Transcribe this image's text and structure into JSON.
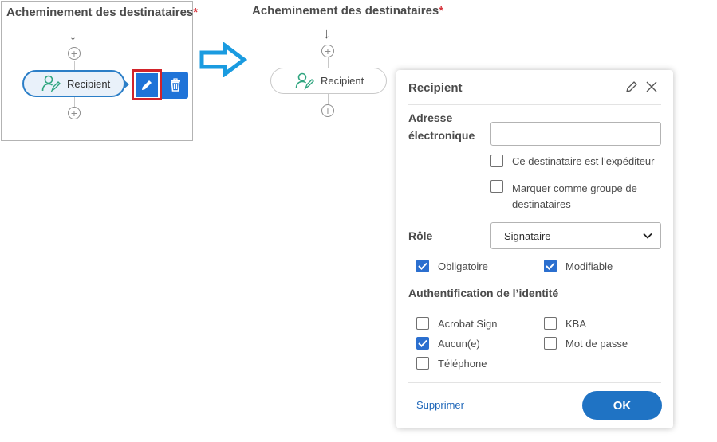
{
  "left": {
    "title": "Acheminement des destinataires",
    "required_mark": "*",
    "recipient_label": "Recipient",
    "edit_icon": "pencil-icon",
    "delete_icon": "trash-icon"
  },
  "transition_arrow": "right-arrow-icon",
  "right": {
    "title": "Acheminement des destinataires",
    "required_mark": "*",
    "recipient_label": "Recipient"
  },
  "panel": {
    "title": "Recipient",
    "email_label_line1": "Adresse",
    "email_label_line2": "électronique",
    "email_value": "",
    "sender_checkbox": {
      "label": "Ce destinataire est l’expéditeur",
      "checked": false
    },
    "group_checkbox": {
      "label_line1": "Marquer comme groupe de",
      "label_line2": "destinataires",
      "checked": false
    },
    "role_label": "Rôle",
    "role_value": "Signataire",
    "required_checkbox": {
      "label": "Obligatoire",
      "checked": true
    },
    "editable_checkbox": {
      "label": "Modifiable",
      "checked": true
    },
    "auth_title": "Authentification de l’identité",
    "auth_options": [
      {
        "label": "Acrobat Sign",
        "checked": false
      },
      {
        "label": "KBA",
        "checked": false
      },
      {
        "label": "Aucun(e)",
        "checked": true
      },
      {
        "label": "Mot de passe",
        "checked": false
      },
      {
        "label": "Téléphone",
        "checked": false
      }
    ],
    "delete_link": "Supprimer",
    "ok_button": "OK"
  },
  "colors": {
    "accent": "#1f73c4",
    "highlight_frame": "#d2232a",
    "required": "#d7373f",
    "recipient_icon": "#2fa57f",
    "transition_arrow": "#1a9be0"
  }
}
